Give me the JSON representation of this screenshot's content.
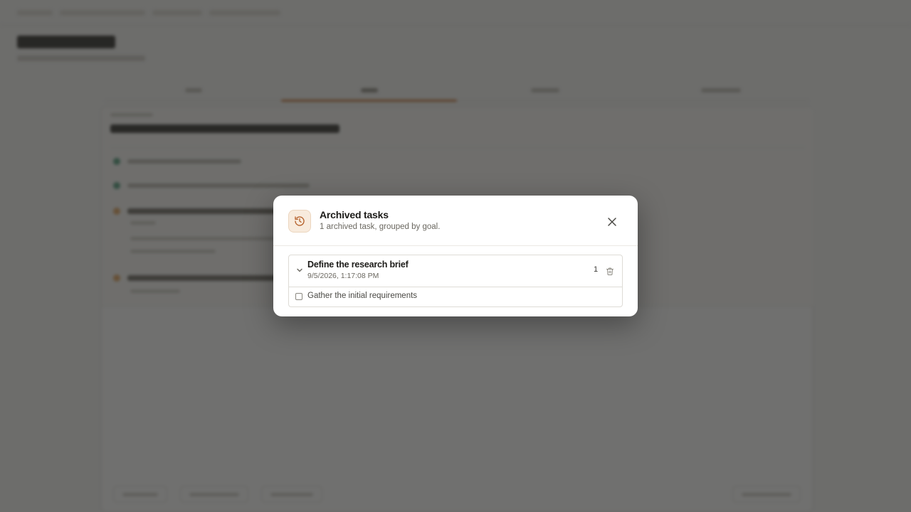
{
  "colors": {
    "accent": "#c26b2a",
    "icon_bg": "#f8ebdd",
    "overlay": "rgba(38,38,36,0.66)"
  },
  "modal": {
    "title": "Archived tasks",
    "subtitle": "1 archived task, grouped by goal.",
    "header_icon": "history-icon",
    "close_icon": "close-icon",
    "groups": [
      {
        "title": "Define the research brief",
        "date": "9/5/2026, 1:17:08 PM",
        "count": "1",
        "expand_icon": "chevron-down-icon",
        "delete_icon": "trash-icon",
        "tasks": [
          {
            "label": "Gather the initial requirements",
            "checked": false
          }
        ]
      }
    ]
  }
}
